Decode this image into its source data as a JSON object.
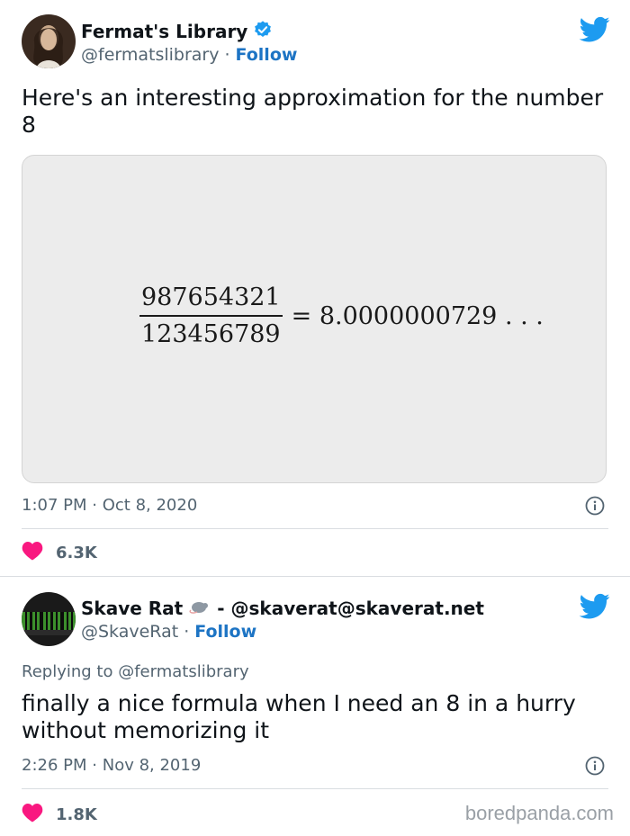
{
  "tweet1": {
    "author_name": "Fermat's Library",
    "handle": "@fermatslibrary",
    "separator": "·",
    "follow_label": "Follow",
    "text": "Here's an interesting approximation for the number 8",
    "formula": {
      "numerator": "987654321",
      "denominator": "123456789",
      "result": "= 8.0000000729 . . ."
    },
    "time": "1:07 PM",
    "date": "Oct 8, 2020",
    "likes": "6.3K"
  },
  "tweet2": {
    "author_name": "Skave Rat",
    "author_suffix": "- @skaverat@skaverat.net",
    "handle": "@SkaveRat",
    "separator": "·",
    "follow_label": "Follow",
    "replying_prefix": "Replying to",
    "replying_to": "@fermatslibrary",
    "text": "finally a nice formula when I need an 8 in a hurry without memorizing it",
    "time": "2:26 PM",
    "date": "Nov 8, 2019",
    "likes": "1.8K"
  },
  "meta_separator": "·",
  "watermark": "boredpanda.com",
  "colors": {
    "twitter_blue": "#1d9bf0",
    "like_pink": "#f91880",
    "verified_blue": "#1d9bf0"
  }
}
